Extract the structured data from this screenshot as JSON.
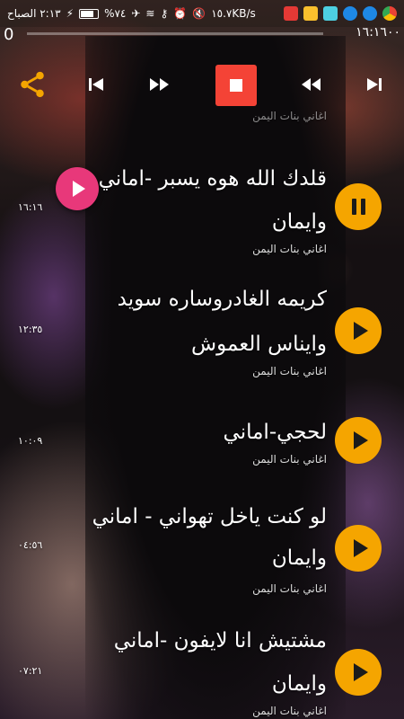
{
  "status_bar": {
    "time": "٢:١٣ الصباح",
    "battery": "%٧٤",
    "network_speed": "١٥.٧KB/s"
  },
  "player": {
    "current_time": "0",
    "duration": "١٦:١٦٠٠"
  },
  "songs": [
    {
      "title_line1": "قلدك الله هوه يسبر -اماني",
      "title_line2": "وايمان",
      "artist": "اغاني بنات اليمن",
      "duration": "١٦:١٦",
      "state": "playing"
    },
    {
      "title_line1": "كريمه الغادروساره سويد",
      "title_line2": "وايناس العموش",
      "artist": "اغاني بنات اليمن",
      "duration": "١٢:٣٥",
      "state": "paused"
    },
    {
      "title_line1": "لحجي-اماني",
      "title_line2": "",
      "artist": "اغاني بنات اليمن",
      "duration": "١٠:٠٩",
      "state": "paused"
    },
    {
      "title_line1": "لو كنت ياخل تهواني - اماني",
      "title_line2": "وايمان",
      "artist": "اغاني بنات اليمن",
      "duration": "٠٤:٥٦",
      "state": "paused"
    },
    {
      "title_line1": "مشتيش انا لايفون -اماني",
      "title_line2": "وايمان",
      "artist": "اغاني بنات اليمن",
      "duration": "٠٧:٢١",
      "state": "paused"
    }
  ],
  "icons": {
    "share": "share-icon",
    "prev": "skip-previous-icon",
    "fast_forward": "fast-forward-icon",
    "stop": "stop-icon",
    "rewind": "rewind-icon",
    "next": "skip-next-icon"
  },
  "colors": {
    "accent": "#f5a500",
    "stop": "#f44336",
    "fab": "#e8387a"
  }
}
